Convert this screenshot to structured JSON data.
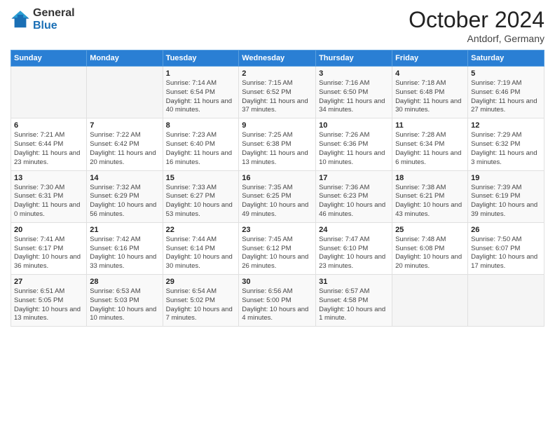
{
  "header": {
    "logo": {
      "general": "General",
      "blue": "Blue"
    },
    "month": "October 2024",
    "location": "Antdorf, Germany"
  },
  "weekdays": [
    "Sunday",
    "Monday",
    "Tuesday",
    "Wednesday",
    "Thursday",
    "Friday",
    "Saturday"
  ],
  "weeks": [
    [
      {
        "day": "",
        "info": ""
      },
      {
        "day": "",
        "info": ""
      },
      {
        "day": "1",
        "info": "Sunrise: 7:14 AM\nSunset: 6:54 PM\nDaylight: 11 hours and 40 minutes."
      },
      {
        "day": "2",
        "info": "Sunrise: 7:15 AM\nSunset: 6:52 PM\nDaylight: 11 hours and 37 minutes."
      },
      {
        "day": "3",
        "info": "Sunrise: 7:16 AM\nSunset: 6:50 PM\nDaylight: 11 hours and 34 minutes."
      },
      {
        "day": "4",
        "info": "Sunrise: 7:18 AM\nSunset: 6:48 PM\nDaylight: 11 hours and 30 minutes."
      },
      {
        "day": "5",
        "info": "Sunrise: 7:19 AM\nSunset: 6:46 PM\nDaylight: 11 hours and 27 minutes."
      }
    ],
    [
      {
        "day": "6",
        "info": "Sunrise: 7:21 AM\nSunset: 6:44 PM\nDaylight: 11 hours and 23 minutes."
      },
      {
        "day": "7",
        "info": "Sunrise: 7:22 AM\nSunset: 6:42 PM\nDaylight: 11 hours and 20 minutes."
      },
      {
        "day": "8",
        "info": "Sunrise: 7:23 AM\nSunset: 6:40 PM\nDaylight: 11 hours and 16 minutes."
      },
      {
        "day": "9",
        "info": "Sunrise: 7:25 AM\nSunset: 6:38 PM\nDaylight: 11 hours and 13 minutes."
      },
      {
        "day": "10",
        "info": "Sunrise: 7:26 AM\nSunset: 6:36 PM\nDaylight: 11 hours and 10 minutes."
      },
      {
        "day": "11",
        "info": "Sunrise: 7:28 AM\nSunset: 6:34 PM\nDaylight: 11 hours and 6 minutes."
      },
      {
        "day": "12",
        "info": "Sunrise: 7:29 AM\nSunset: 6:32 PM\nDaylight: 11 hours and 3 minutes."
      }
    ],
    [
      {
        "day": "13",
        "info": "Sunrise: 7:30 AM\nSunset: 6:31 PM\nDaylight: 11 hours and 0 minutes."
      },
      {
        "day": "14",
        "info": "Sunrise: 7:32 AM\nSunset: 6:29 PM\nDaylight: 10 hours and 56 minutes."
      },
      {
        "day": "15",
        "info": "Sunrise: 7:33 AM\nSunset: 6:27 PM\nDaylight: 10 hours and 53 minutes."
      },
      {
        "day": "16",
        "info": "Sunrise: 7:35 AM\nSunset: 6:25 PM\nDaylight: 10 hours and 49 minutes."
      },
      {
        "day": "17",
        "info": "Sunrise: 7:36 AM\nSunset: 6:23 PM\nDaylight: 10 hours and 46 minutes."
      },
      {
        "day": "18",
        "info": "Sunrise: 7:38 AM\nSunset: 6:21 PM\nDaylight: 10 hours and 43 minutes."
      },
      {
        "day": "19",
        "info": "Sunrise: 7:39 AM\nSunset: 6:19 PM\nDaylight: 10 hours and 39 minutes."
      }
    ],
    [
      {
        "day": "20",
        "info": "Sunrise: 7:41 AM\nSunset: 6:17 PM\nDaylight: 10 hours and 36 minutes."
      },
      {
        "day": "21",
        "info": "Sunrise: 7:42 AM\nSunset: 6:16 PM\nDaylight: 10 hours and 33 minutes."
      },
      {
        "day": "22",
        "info": "Sunrise: 7:44 AM\nSunset: 6:14 PM\nDaylight: 10 hours and 30 minutes."
      },
      {
        "day": "23",
        "info": "Sunrise: 7:45 AM\nSunset: 6:12 PM\nDaylight: 10 hours and 26 minutes."
      },
      {
        "day": "24",
        "info": "Sunrise: 7:47 AM\nSunset: 6:10 PM\nDaylight: 10 hours and 23 minutes."
      },
      {
        "day": "25",
        "info": "Sunrise: 7:48 AM\nSunset: 6:08 PM\nDaylight: 10 hours and 20 minutes."
      },
      {
        "day": "26",
        "info": "Sunrise: 7:50 AM\nSunset: 6:07 PM\nDaylight: 10 hours and 17 minutes."
      }
    ],
    [
      {
        "day": "27",
        "info": "Sunrise: 6:51 AM\nSunset: 5:05 PM\nDaylight: 10 hours and 13 minutes."
      },
      {
        "day": "28",
        "info": "Sunrise: 6:53 AM\nSunset: 5:03 PM\nDaylight: 10 hours and 10 minutes."
      },
      {
        "day": "29",
        "info": "Sunrise: 6:54 AM\nSunset: 5:02 PM\nDaylight: 10 hours and 7 minutes."
      },
      {
        "day": "30",
        "info": "Sunrise: 6:56 AM\nSunset: 5:00 PM\nDaylight: 10 hours and 4 minutes."
      },
      {
        "day": "31",
        "info": "Sunrise: 6:57 AM\nSunset: 4:58 PM\nDaylight: 10 hours and 1 minute."
      },
      {
        "day": "",
        "info": ""
      },
      {
        "day": "",
        "info": ""
      }
    ]
  ]
}
